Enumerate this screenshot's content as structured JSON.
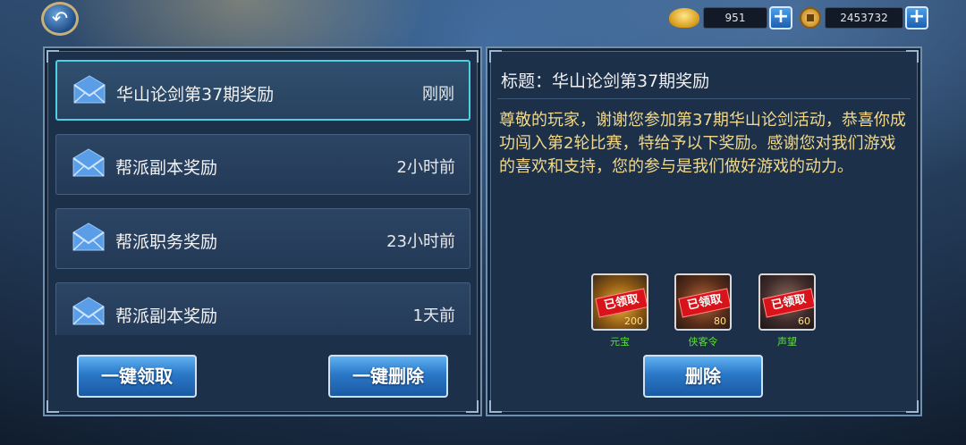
{
  "currency": {
    "ingot": "951",
    "coins": "2453732"
  },
  "mail_list": [
    {
      "title": "华山论剑第37期奖励",
      "time": "刚刚",
      "selected": true
    },
    {
      "title": "帮派副本奖励",
      "time": "2小时前"
    },
    {
      "title": "帮派职务奖励",
      "time": "23小时前"
    },
    {
      "title": "帮派副本奖励",
      "time": "1天前"
    }
  ],
  "left_buttons": {
    "claim_all": "一键领取",
    "delete_all": "一键删除"
  },
  "message": {
    "heading": "标题：华山论剑第37期奖励",
    "body": "尊敬的玩家，谢谢您参加第37期华山论剑活动，恭喜你成功闯入第2轮比赛，特给予以下奖励。感谢您对我们游戏的喜欢和支持，您的参与是我们做好游戏的动力。",
    "rewards": [
      {
        "name": "元宝",
        "qty": "200",
        "stamp": "已领取"
      },
      {
        "name": "侠客令",
        "qty": "80",
        "stamp": "已领取"
      },
      {
        "name": "声望",
        "qty": "60",
        "stamp": "已领取"
      }
    ],
    "delete_label": "删除"
  },
  "colors": {
    "accent_cyan": "#4fd0e3",
    "reward_name_green": "#5fdc3a",
    "body_text_gold": "#f1d88a"
  }
}
